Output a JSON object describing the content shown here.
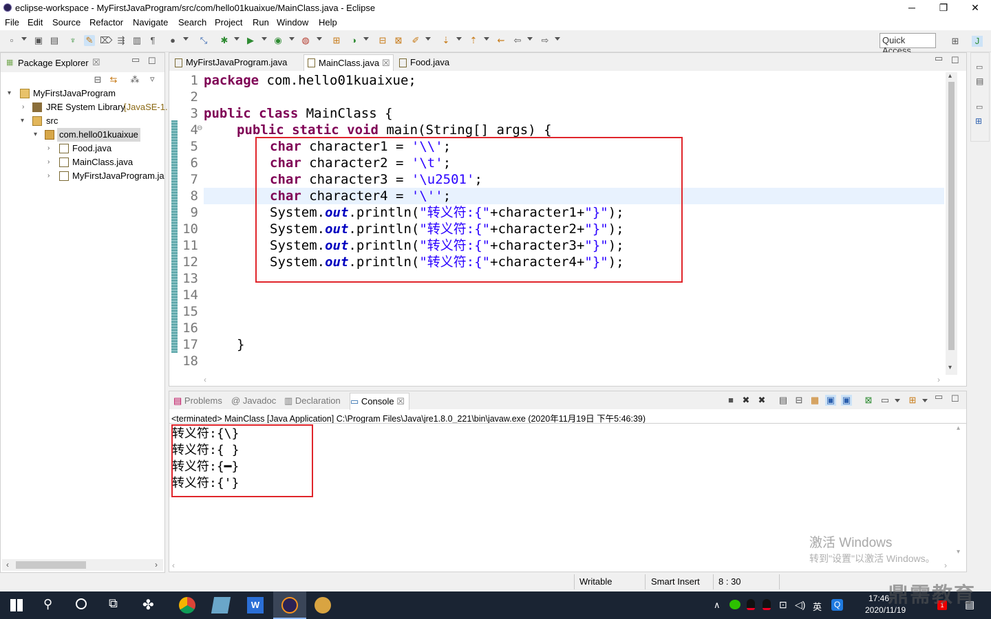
{
  "window": {
    "title": "eclipse-workspace - MyFirstJavaProgram/src/com/hello01kuaixue/MainClass.java - Eclipse",
    "minimize": "─",
    "maximize": "❐",
    "close": "✕"
  },
  "menu": [
    "File",
    "Edit",
    "Source",
    "Refactor",
    "Navigate",
    "Search",
    "Project",
    "Run",
    "Window",
    "Help"
  ],
  "toolbar": {
    "quick_access": "Quick Access"
  },
  "package_explorer": {
    "title": "Package Explorer",
    "close": "☒",
    "tree": [
      {
        "label": "MyFirstJavaProgram",
        "level": 0,
        "expanded": true,
        "icon": "project-icon"
      },
      {
        "label": "JRE System Library",
        "suffix": "[JavaSE-1.",
        "level": 1,
        "expanded": false,
        "icon": "library-icon"
      },
      {
        "label": "src",
        "level": 1,
        "expanded": true,
        "icon": "source-folder-icon"
      },
      {
        "label": "com.hello01kuaixue",
        "level": 2,
        "expanded": true,
        "icon": "package-icon",
        "selected": true
      },
      {
        "label": "Food.java",
        "level": 3,
        "expanded": false,
        "icon": "java-file-icon"
      },
      {
        "label": "MainClass.java",
        "level": 3,
        "expanded": false,
        "icon": "java-file-icon"
      },
      {
        "label": "MyFirstJavaProgram.ja",
        "level": 3,
        "expanded": false,
        "icon": "java-file-icon"
      }
    ]
  },
  "editor": {
    "tabs": [
      {
        "label": "MyFirstJavaProgram.java",
        "active": false
      },
      {
        "label": "MainClass.java",
        "active": true,
        "close": "☒"
      },
      {
        "label": "Food.java",
        "active": false
      }
    ],
    "line_numbers": [
      "1",
      "2",
      "3",
      "4",
      "5",
      "6",
      "7",
      "8",
      "9",
      "10",
      "11",
      "12",
      "13",
      "14",
      "15",
      "16",
      "17",
      "18"
    ],
    "current_line": 8,
    "code": {
      "l1": {
        "kw": "package",
        "rest": " com.hello01kuaixue;"
      },
      "l3": {
        "kw": "public class",
        "rest": " MainClass {"
      },
      "l4": {
        "kw": "public static void",
        "rest": " main(String[] args) {"
      },
      "l5": {
        "kw": "char",
        "var": " character1 = ",
        "str": "'\\\\'",
        "end": ";"
      },
      "l6": {
        "kw": "char",
        "var": " character2 = ",
        "str": "'\\t'",
        "end": ";"
      },
      "l7": {
        "kw": "char",
        "var": " character3 = ",
        "str": "'\\u2501'",
        "end": ";"
      },
      "l8": {
        "kw": "char",
        "var": " character4 = ",
        "str": "'\\''",
        "end": ";"
      },
      "println": [
        {
          "a": "System.",
          "f": "out",
          "b": ".println(",
          "s1": "\"转义符:{\"",
          "c": "+character1+",
          "s2": "\"}\"",
          "e": ");"
        },
        {
          "a": "System.",
          "f": "out",
          "b": ".println(",
          "s1": "\"转义符:{\"",
          "c": "+character2+",
          "s2": "\"}\"",
          "e": ");"
        },
        {
          "a": "System.",
          "f": "out",
          "b": ".println(",
          "s1": "\"转义符:{\"",
          "c": "+character3+",
          "s2": "\"}\"",
          "e": ");"
        },
        {
          "a": "System.",
          "f": "out",
          "b": ".println(",
          "s1": "\"转义符:{\"",
          "c": "+character4+",
          "s2": "\"}\"",
          "e": ");"
        }
      ],
      "l17": "}"
    }
  },
  "console": {
    "tabs": [
      "Problems",
      "Javadoc",
      "Declaration",
      "Console"
    ],
    "active_tab": "Console",
    "header": "<terminated> MainClass [Java Application] C:\\Program Files\\Java\\jre1.8.0_221\\bin\\javaw.exe (2020年11月19日 下午5:46:39)",
    "output": [
      "转义符:{\\}",
      "转义符:{\t}",
      "转义符:{━}",
      "转义符:{'}"
    ]
  },
  "statusbar": {
    "writable": "Writable",
    "insert_mode": "Smart Insert",
    "position": "8 : 30"
  },
  "watermark": {
    "line1": "激活 Windows",
    "line2": "转到\"设置\"以激活 Windows。",
    "brand": "鼎需教育"
  },
  "taskbar": {
    "time": "17:46",
    "date": "2020/11/19",
    "ime": "英",
    "notif_count": "1"
  },
  "colors": {
    "keyword": "#7f0055",
    "string": "#2a00ff",
    "field": "#0000c0",
    "highlight": "#e0252b",
    "current_line": "#e8f2fe"
  }
}
